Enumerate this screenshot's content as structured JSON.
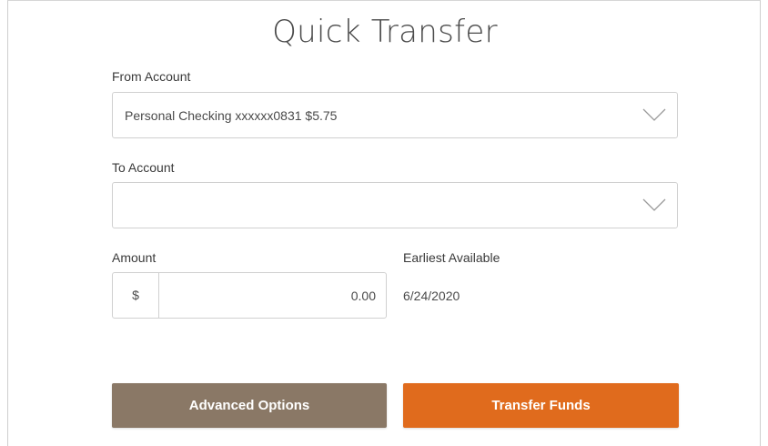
{
  "form": {
    "title": "Quick Transfer",
    "from_account": {
      "label": "From Account",
      "selected": "Personal Checking xxxxxx0831 $5.75",
      "icon": "chevron-down-icon"
    },
    "to_account": {
      "label": "To Account",
      "selected": "",
      "icon": "chevron-down-icon"
    },
    "amount": {
      "label": "Amount",
      "currency_symbol": "$",
      "value": "0.00"
    },
    "earliest_available": {
      "label": "Earliest Available",
      "date": "6/24/2020"
    }
  },
  "actions": {
    "advanced_label": "Advanced Options",
    "transfer_label": "Transfer Funds"
  },
  "colors": {
    "advanced_button": "#8a7866",
    "transfer_button": "#e06b1d",
    "border": "#d0d0d0"
  }
}
